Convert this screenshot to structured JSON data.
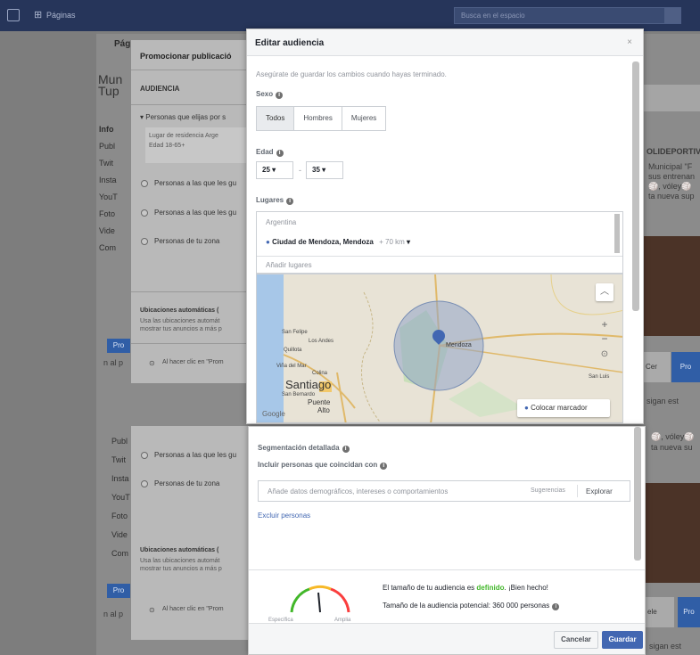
{
  "topbar": {
    "pages_label": "Páginas",
    "search_placeholder": "Busca en el espacio"
  },
  "background": {
    "tab_label": "Pág",
    "page_heading_line1": "Mun",
    "page_heading_line2": "Tup",
    "side_items": [
      "Info",
      "Publ",
      "Twit",
      "Insta",
      "YouT",
      "Foto",
      "Vide",
      "Com"
    ],
    "side_items_lower": [
      "Publ",
      "Twit",
      "Insta",
      "YouT",
      "Foto",
      "Vide",
      "Com"
    ],
    "right_heading": "OLIDEPORTIV",
    "right_lines": [
      "Municipal \"F",
      "sus entrenan",
      "🏐, vóley🏐",
      "ta nueva sup"
    ],
    "right_lines_lower": [
      "🏐, vóley🏐",
      "ta nueva su"
    ],
    "right_button": "Pro",
    "right_note": "sigan est",
    "right_button_lower": "Pro",
    "right_note_lower": "sigan est",
    "left_button": "Pro",
    "left_note": "n al p"
  },
  "promo": {
    "title": "Promocionar publicació",
    "audience_label": "AUDIENCIA",
    "opt_selected": "Personas que elijas por s",
    "sub1": "Lugar de residencia Arge",
    "sub2": "Edad 18-65+",
    "opt2": "Personas a las que les gu",
    "opt3": "Personas a las que les gu",
    "opt4": "Personas de tu zona",
    "placements_title": "Ubicaciones automáticas (",
    "placements_l1": "Usa las ubicaciones automát",
    "placements_l2": "mostrar tus anuncios a más p",
    "footer_note": "Al hacer clic en \"Prom"
  },
  "promo2": {
    "opt2": "Personas a las que les gu",
    "opt4": "Personas de tu zona",
    "placements_title": "Ubicaciones automáticas (",
    "placements_l1": "Usa las ubicaciones automát",
    "placements_l2": "mostrar tus anuncios a más p",
    "footer_note": "Al hacer clic en \"Prom"
  },
  "edit": {
    "title": "Editar audiencia",
    "close": "×",
    "hint": "Asegúrate de guardar los cambios cuando hayas terminado.",
    "sex_label": "Sexo",
    "sex_options": [
      "Todos",
      "Hombres",
      "Mujeres"
    ],
    "age_label": "Edad",
    "age_min": "25",
    "age_max": "35",
    "age_sep": "-",
    "places_label": "Lugares",
    "country": "Argentina",
    "city": "Ciudad de Mendoza, Mendoza",
    "radius": "+ 70 km",
    "add_places_placeholder": "Añadir lugares",
    "map_labels": {
      "mendoza": "Mendoza",
      "santiago": "Santiago",
      "san_felipe": "San Felipe",
      "los_andes": "Los Andes",
      "vina": "Viña del Mar",
      "vina2": "Quillota",
      "colina": "Colina",
      "san_bernardo": "San Bernardo",
      "puente": "Puente",
      "alto": "Alto",
      "san_luis": "San Luis",
      "google": "Google"
    },
    "drop_pin": "Colocar marcador"
  },
  "edit2": {
    "detailed_label": "Segmentación detallada",
    "include_label": "Incluir personas que coincidan con",
    "search_placeholder": "Añade datos demográficos, intereses o comportamientos",
    "suggestions": "Sugerencias",
    "explore": "Explorar",
    "exclude": "Excluir personas",
    "gauge_left": "Específica",
    "gauge_right": "Amplia",
    "size_text_1": "El tamaño de tu audiencia es",
    "size_defined": "definido",
    "size_text_2": ". ¡Bien hecho!",
    "potential": "Tamaño de la audiencia potencial: 360 000 personas",
    "cancel": "Cancelar",
    "save": "Guardar"
  },
  "colors": {
    "brand_blue": "#4267b2",
    "topbar": "#26355a",
    "green": "#42b72a"
  }
}
